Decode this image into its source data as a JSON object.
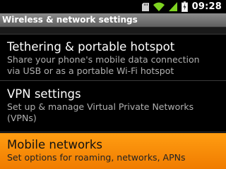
{
  "status_bar": {
    "time": "09:28",
    "icons": [
      "sd-card-icon",
      "wifi-icon",
      "signal-icon",
      "battery-icon"
    ]
  },
  "title_bar": {
    "title": "Wireless & network settings"
  },
  "settings": [
    {
      "title": "Tethering & portable hotspot",
      "summary_lines": [
        "Share your phone's mobile data connection",
        "via USB or as a portable Wi-Fi hotspot"
      ]
    },
    {
      "title": "VPN settings",
      "summary_lines": [
        "Set up & manage Virtual Private Networks",
        "(VPNs)"
      ]
    },
    {
      "title": "Mobile networks",
      "summary_lines": [
        "Set options for roaming, networks, APNs"
      ],
      "selected": true
    }
  ],
  "colors": {
    "highlight": "#f58a00",
    "title_bar": "#7a7a7a",
    "background": "#000000"
  }
}
